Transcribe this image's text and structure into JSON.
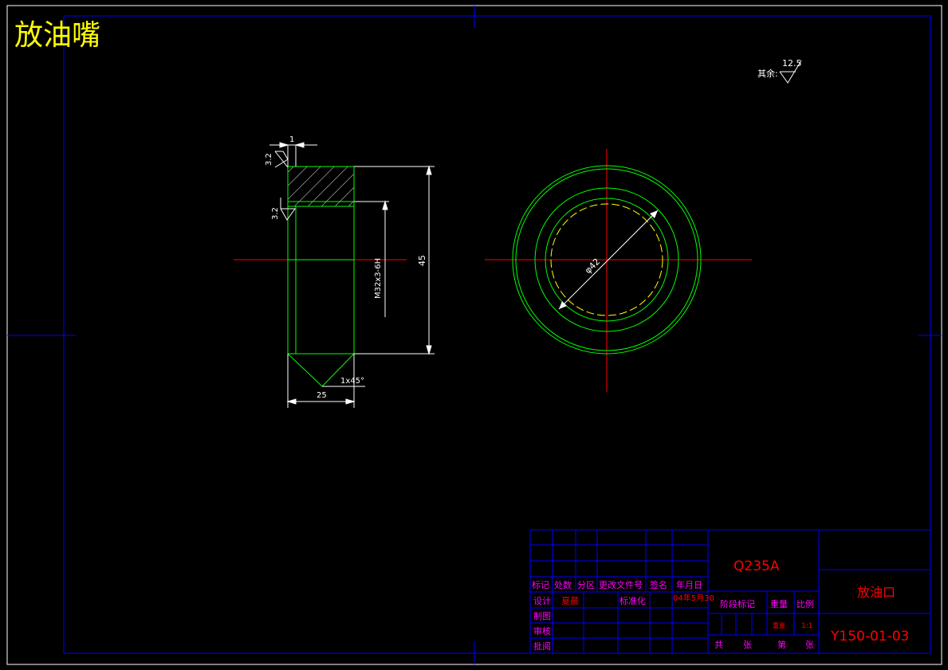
{
  "title": "放油嘴",
  "roughness": {
    "other_label": "其余:",
    "other_value": "12.5",
    "top_value": "3.2",
    "mid_value": "3.2"
  },
  "dimensions": {
    "chamfer_small": "1",
    "thread": "M32x3-6H",
    "height": "45",
    "chamfer": "1x45°",
    "width": "25",
    "diameter": "φ42"
  },
  "title_block": {
    "material": "Q235A",
    "part_name": "放油口",
    "drawing_number": "Y150-01-03",
    "headers": [
      "标记",
      "处数",
      "分区",
      "更改文件号",
      "签名",
      "年月日"
    ],
    "design_label": "设计",
    "designer": "夏晨",
    "standardize_label": "标准化",
    "date": "04年5月30",
    "stage_label": "阶段标记",
    "weight_label": "重量",
    "scale_label": "比例",
    "weight_value": "重量",
    "scale_value": "1:1",
    "drafting_label": "制图",
    "check_label": "审核",
    "approve_label": "批阅",
    "total_label": "共",
    "sheets_label": "张",
    "sheet_label": "第",
    "sheet_suffix": "张"
  },
  "colors": {
    "frame": "#0000ff",
    "outline": "#00ff00",
    "center": "#ff0000",
    "dim": "#ffffff",
    "title": "#ffff00",
    "label": "#ff00ff",
    "value": "#ff0000"
  }
}
